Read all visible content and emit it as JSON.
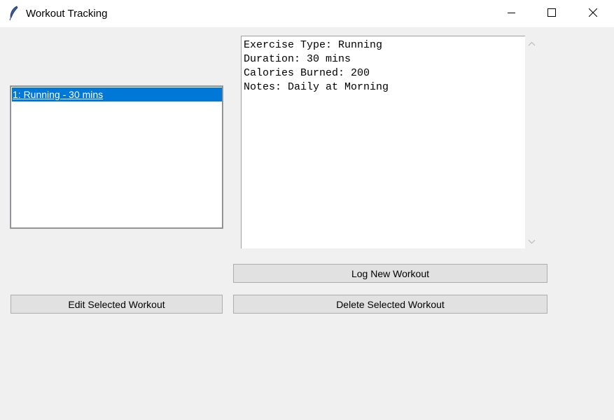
{
  "window": {
    "title": "Workout Tracking",
    "app_icon": "feather-icon",
    "controls": [
      "minimize-icon",
      "maximize-icon",
      "close-icon"
    ]
  },
  "workouts_list": {
    "items": [
      {
        "label": "1: Running - 30 mins",
        "selected": true
      }
    ],
    "selected_color": "#0078d7"
  },
  "details": {
    "lines": [
      "Exercise Type: Running",
      "Duration: 30 mins",
      "Calories Burned: 200",
      "Notes: Daily at Morning"
    ]
  },
  "buttons": {
    "log_new": "Log New Workout",
    "edit_selected": "Edit Selected Workout",
    "delete_selected": "Delete Selected Workout"
  }
}
